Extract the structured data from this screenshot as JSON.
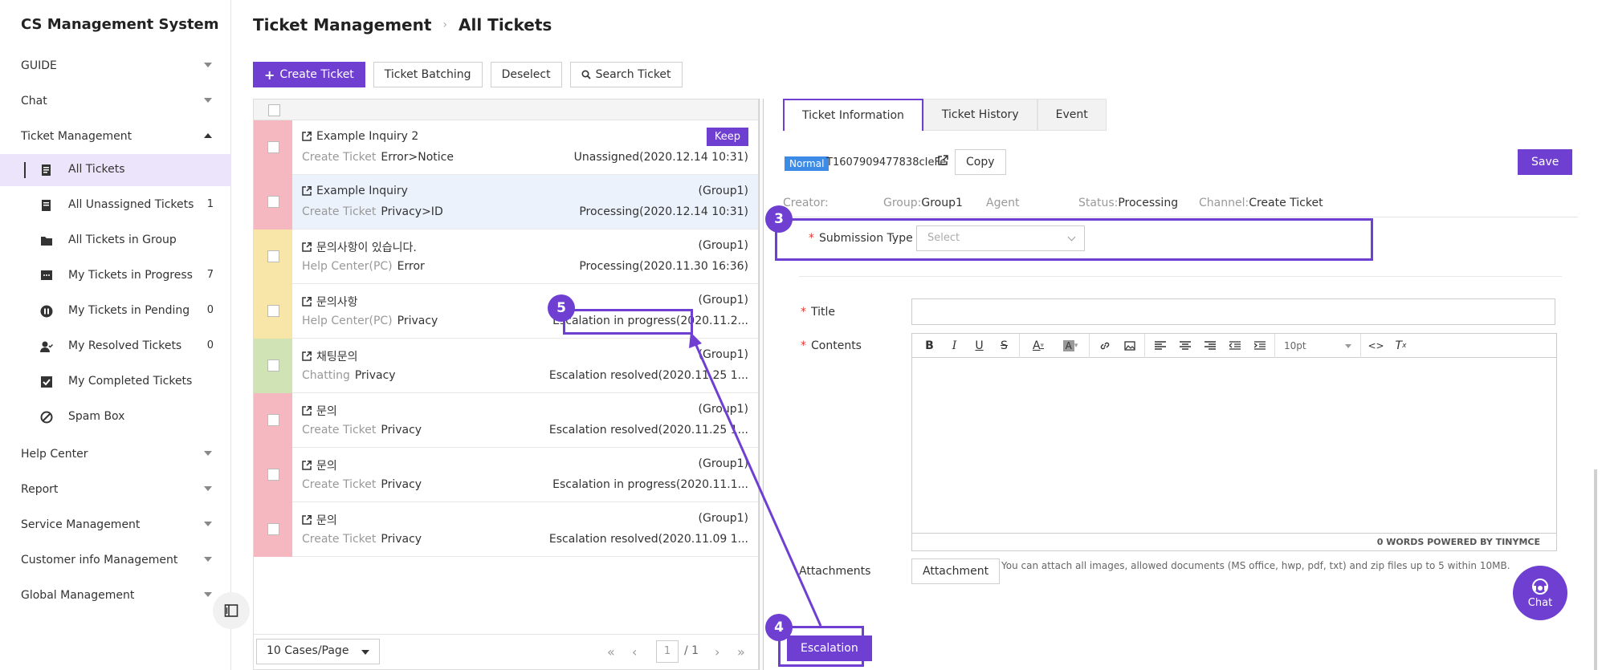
{
  "app_title": "CS Management System",
  "sidebar": {
    "sections_top": [
      {
        "label": "GUIDE"
      },
      {
        "label": "Chat"
      },
      {
        "label": "Ticket Management"
      }
    ],
    "ticket_items": [
      {
        "label": "All Tickets",
        "count": ""
      },
      {
        "label": "All Unassigned Tickets",
        "count": "1"
      },
      {
        "label": "All Tickets in Group",
        "count": ""
      },
      {
        "label": "My Tickets in Progress",
        "count": "7"
      },
      {
        "label": "My Tickets in Pending",
        "count": "0"
      },
      {
        "label": "My Resolved Tickets",
        "count": "0"
      },
      {
        "label": "My Completed Tickets",
        "count": ""
      },
      {
        "label": "Spam Box",
        "count": ""
      }
    ],
    "sections_bottom": [
      {
        "label": "Help Center"
      },
      {
        "label": "Report"
      },
      {
        "label": "Service Management"
      },
      {
        "label": "Customer info Management"
      },
      {
        "label": "Global Management"
      }
    ]
  },
  "breadcrumb": {
    "parent": "Ticket Management",
    "current": "All Tickets"
  },
  "toolbar": {
    "create": "Create Ticket",
    "batching": "Ticket Batching",
    "deselect": "Deselect",
    "search": "Search Ticket"
  },
  "tickets": [
    {
      "title": "Example Inquiry 2",
      "source": "Create Ticket",
      "category": "Error>Notice",
      "group": "",
      "status": "Unassigned(2020.12.14 10:31)",
      "keep": "Keep",
      "color": "#f5b8c1"
    },
    {
      "title": "Example Inquiry",
      "source": "Create Ticket",
      "category": "Privacy>ID",
      "group": "(Group1)",
      "status": "Processing(2020.12.14 10:31)",
      "keep": "",
      "color": "#f5b8c1"
    },
    {
      "title": "문의사항이 있습니다.",
      "source": "Help Center(PC)",
      "category": "Error",
      "group": "(Group1)",
      "status": "Processing(2020.11.30 16:36)",
      "keep": "",
      "color": "#f7e6a8"
    },
    {
      "title": "문의사항",
      "source": "Help Center(PC)",
      "category": "Privacy",
      "group": "(Group1)",
      "status": "Escalation in progress(2020.11.2...",
      "keep": "",
      "color": "#f7e6a8"
    },
    {
      "title": "채팅문의",
      "source": "Chatting",
      "category": "Privacy",
      "group": "(Group1)",
      "status": "Escalation resolved(2020.11.25 1...",
      "keep": "",
      "color": "#cfe3b4"
    },
    {
      "title": "문의",
      "source": "Create Ticket",
      "category": "Privacy",
      "group": "(Group1)",
      "status": "Escalation resolved(2020.11.25 1...",
      "keep": "",
      "color": "#f5b8c1"
    },
    {
      "title": "문의",
      "source": "Create Ticket",
      "category": "Privacy",
      "group": "(Group1)",
      "status": "Escalation in progress(2020.11.1...",
      "keep": "",
      "color": "#f5b8c1"
    },
    {
      "title": "문의",
      "source": "Create Ticket",
      "category": "Privacy",
      "group": "(Group1)",
      "status": "Escalation resolved(2020.11.09 1...",
      "keep": "",
      "color": "#f5b8c1"
    }
  ],
  "pager": {
    "per_page": "10 Cases/Page",
    "page": "1",
    "total": "/ 1"
  },
  "detail": {
    "tabs": [
      "Ticket Information",
      "Ticket History",
      "Event"
    ],
    "badge": "Normal",
    "ticket_id": "T1607909477838cIeFe",
    "copy": "Copy",
    "save": "Save",
    "meta": {
      "creator_label": "Creator:",
      "group_label": "Group:",
      "group_value": "Group1",
      "agent_label": "Agent",
      "status_label": "Status:",
      "status_value": "Processing",
      "channel_label": "Channel:",
      "channel_value": "Create Ticket"
    },
    "submission_type_label": "Submission Type",
    "submission_type_placeholder": "Select",
    "title_label": "Title",
    "contents_label": "Contents",
    "font_size": "10pt",
    "editor_footer": "0 WORDS POWERED BY TINYMCE",
    "attachments_label": "Attachments",
    "attachment_button": "Attachment",
    "attachment_hint": "You can attach all images, allowed documents (MS office, hwp, pdf, txt) and zip files up to 5 within 10MB.",
    "escalation_button": "Escalation"
  },
  "chat_fab": "Chat",
  "annotations": [
    "3",
    "4",
    "5"
  ],
  "colors": {
    "accent": "#6f3fd2",
    "badge_blue": "#3c8ce7"
  }
}
